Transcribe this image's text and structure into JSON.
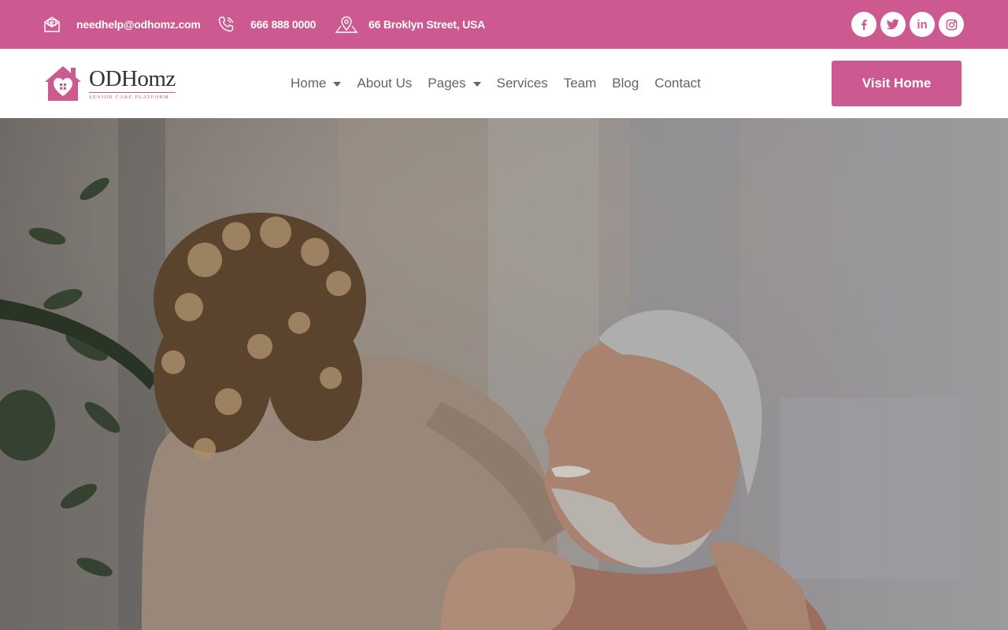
{
  "topbar": {
    "email": "needhelp@odhomz.com",
    "phone": "666 888 0000",
    "address": "66 Broklyn Street, USA",
    "social": [
      {
        "icon": "facebook-icon",
        "glyph": "f"
      },
      {
        "icon": "twitter-icon",
        "glyph": ""
      },
      {
        "icon": "linkedin-icon",
        "glyph": "in"
      },
      {
        "icon": "instagram-icon",
        "glyph": ""
      }
    ]
  },
  "header": {
    "brand_name": "ODHomz",
    "brand_tagline": "SENIOR CARE PLATFORM",
    "nav": [
      {
        "label": "Home",
        "has_dropdown": true
      },
      {
        "label": "About Us",
        "has_dropdown": false
      },
      {
        "label": "Pages",
        "has_dropdown": true
      },
      {
        "label": "Services",
        "has_dropdown": false
      },
      {
        "label": "Team",
        "has_dropdown": false
      },
      {
        "label": "Blog",
        "has_dropdown": false
      },
      {
        "label": "Contact",
        "has_dropdown": false
      }
    ],
    "cta_label": "Visit Home"
  },
  "colors": {
    "accent": "#cc5a90",
    "nav_text": "#6b6161",
    "white": "#ffffff"
  }
}
